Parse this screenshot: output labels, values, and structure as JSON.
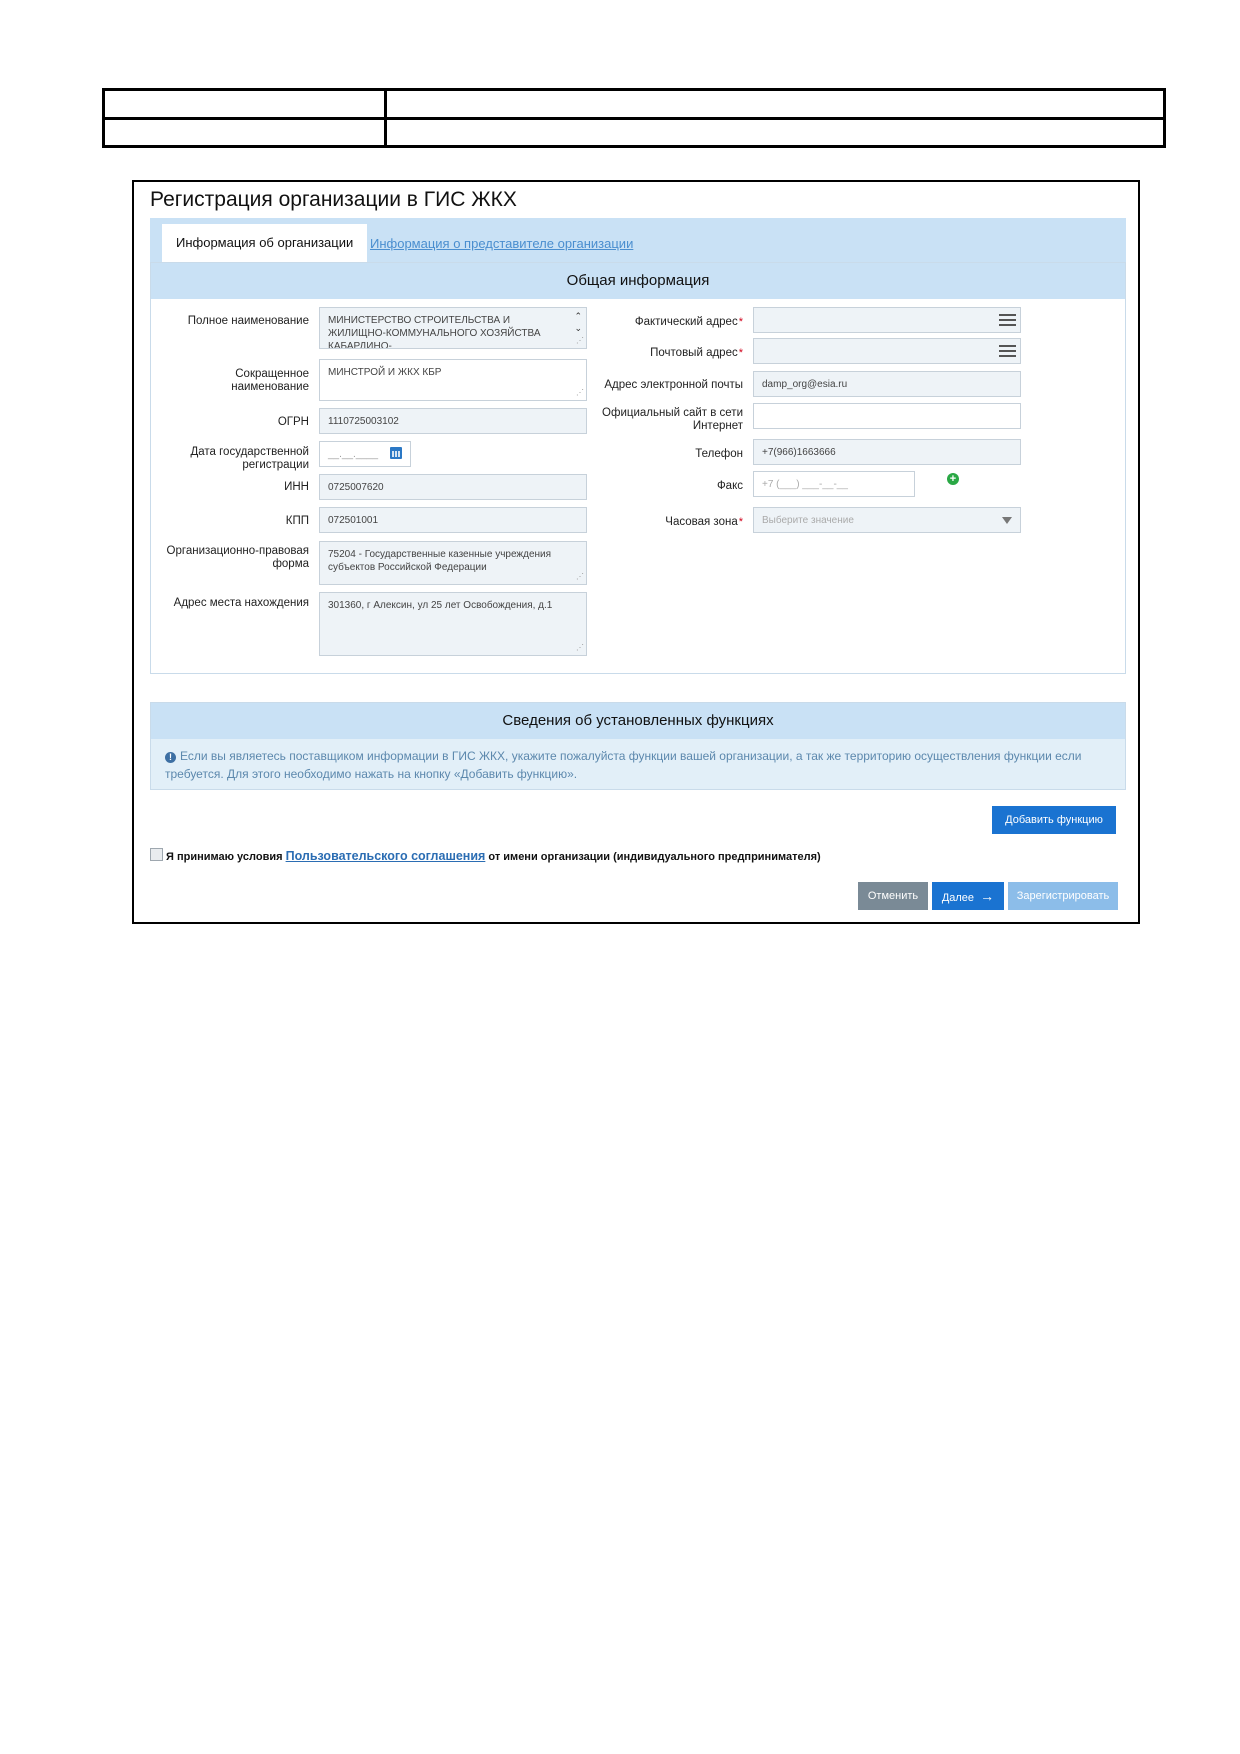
{
  "page": {
    "title": "Регистрация организации в ГИС ЖКХ"
  },
  "tabs": [
    {
      "label": "Информация об организации",
      "active": true
    },
    {
      "label": "Информация о представителе организации",
      "active": false
    }
  ],
  "general": {
    "heading": "Общая информация",
    "left": [
      {
        "label": "Полное наименование",
        "value": "МИНИСТЕРСТВО СТРОИТЕЛЬСТВА И ЖИЛИЩНО-КОММУНАЛЬНОГО ХОЗЯЙСТВА КАБАРДИНО-"
      },
      {
        "label": "Сокращенное наименование",
        "value": "МИНСТРОЙ И ЖКХ КБР"
      },
      {
        "label": "ОГРН",
        "value": "1110725003102"
      },
      {
        "label": "Дата государственной регистрации",
        "value": "__.__.____"
      },
      {
        "label": "ИНН",
        "value": "0725007620"
      },
      {
        "label": "КПП",
        "value": "072501001"
      },
      {
        "label": "Организационно-правовая форма",
        "value": "75204 - Государственные казенные учреждения субъектов Российской Федерации"
      },
      {
        "label": "Адрес места нахождения",
        "value": "301360, г Алексин, ул 25 лет Освобождения, д.1"
      }
    ],
    "right": [
      {
        "label": "Фактический адрес",
        "required": "*",
        "value": ""
      },
      {
        "label": "Почтовый адрес",
        "required": "*",
        "value": ""
      },
      {
        "label": "Адрес электронной почты",
        "value": "damp_org@esia.ru"
      },
      {
        "label": "Официальный сайт в сети Интернет",
        "value": ""
      },
      {
        "label": "Телефон",
        "value": "+7(966)1663666"
      },
      {
        "label": "Факс",
        "value": "+7 (___) ___-__-__"
      },
      {
        "label": "Часовая зона",
        "required": "*",
        "value": "Выберите значение"
      }
    ]
  },
  "functions": {
    "heading": "Сведения об установленных функциях",
    "info": "Если вы являетесь поставщиком информации в ГИС ЖКХ, укажите пожалуйста функции вашей организации, а так же территорию осуществления функции если требуется. Для этого необходимо нажать на кнопку «Добавить функцию».",
    "add_button": "Добавить функцию"
  },
  "agreement": {
    "before": "Я принимаю условия",
    "link": "Пользовательского соглашения",
    "after": "от имени организации (индивидуального предпринимателя)",
    "checked": false
  },
  "buttons": {
    "cancel": "Отменить",
    "next": "Далее",
    "next_arrow": "→",
    "register": "Зарегистрировать"
  },
  "colors": {
    "accent": "#1a73d1",
    "header_bg": "#c9e1f5",
    "field_bg": "#eef3f7",
    "required": "#d0021b"
  }
}
